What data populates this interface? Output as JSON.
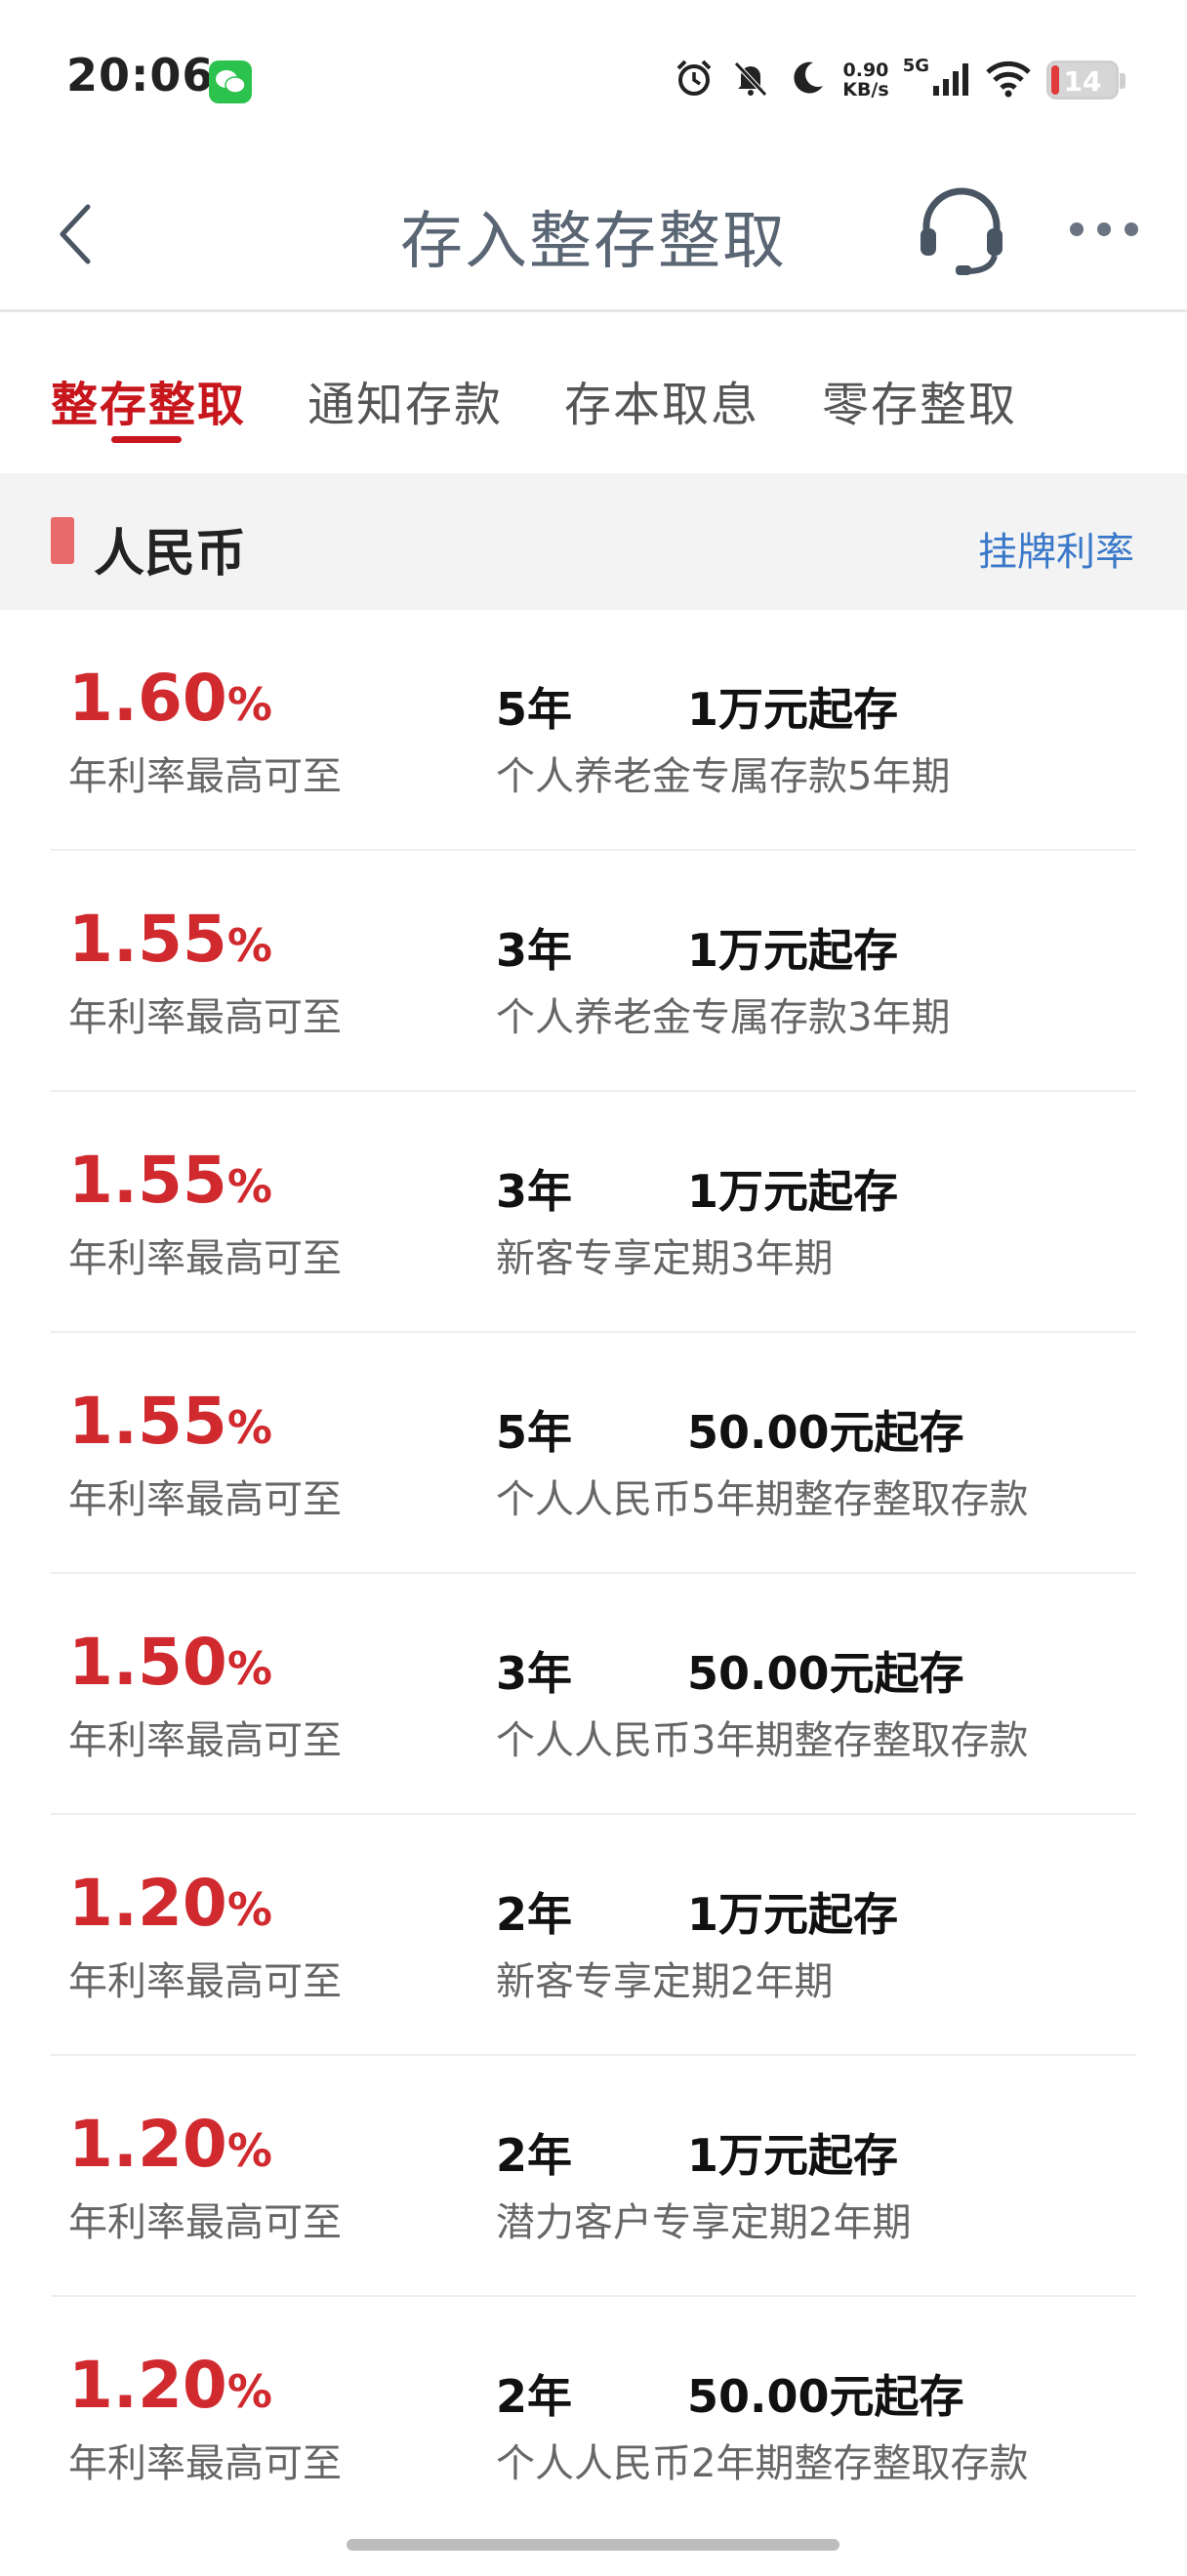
{
  "status_bar": {
    "time": "20:06",
    "net_speed_value": "0.90",
    "net_speed_unit": "KB/s",
    "network_type": "5G",
    "battery_level": "14",
    "icons": [
      "wechat-icon",
      "alarm-icon",
      "mute-icon",
      "moon-icon",
      "signal-icon",
      "wifi-icon",
      "battery-icon"
    ]
  },
  "header": {
    "title": "存入整存整取",
    "icons": [
      "back-arrow-icon",
      "headset-icon",
      "more-icon"
    ]
  },
  "tabs": [
    {
      "label": "整存整取",
      "active": true
    },
    {
      "label": "通知存款",
      "active": false
    },
    {
      "label": "存本取息",
      "active": false
    },
    {
      "label": "零存整取",
      "active": false
    }
  ],
  "section": {
    "title": "人民币",
    "link": "挂牌利率"
  },
  "products": [
    {
      "rate": "1.60",
      "rate_unit": "%",
      "caption": "年利率最高可至",
      "term": "5年",
      "min_deposit": "1万元起存",
      "name": "个人养老金专属存款5年期"
    },
    {
      "rate": "1.55",
      "rate_unit": "%",
      "caption": "年利率最高可至",
      "term": "3年",
      "min_deposit": "1万元起存",
      "name": "个人养老金专属存款3年期"
    },
    {
      "rate": "1.55",
      "rate_unit": "%",
      "caption": "年利率最高可至",
      "term": "3年",
      "min_deposit": "1万元起存",
      "name": "新客专享定期3年期"
    },
    {
      "rate": "1.55",
      "rate_unit": "%",
      "caption": "年利率最高可至",
      "term": "5年",
      "min_deposit": "50.00元起存",
      "name": "个人人民币5年期整存整取存款"
    },
    {
      "rate": "1.50",
      "rate_unit": "%",
      "caption": "年利率最高可至",
      "term": "3年",
      "min_deposit": "50.00元起存",
      "name": "个人人民币3年期整存整取存款"
    },
    {
      "rate": "1.20",
      "rate_unit": "%",
      "caption": "年利率最高可至",
      "term": "2年",
      "min_deposit": "1万元起存",
      "name": "新客专享定期2年期"
    },
    {
      "rate": "1.20",
      "rate_unit": "%",
      "caption": "年利率最高可至",
      "term": "2年",
      "min_deposit": "1万元起存",
      "name": "潜力客户专享定期2年期"
    },
    {
      "rate": "1.20",
      "rate_unit": "%",
      "caption": "年利率最高可至",
      "term": "2年",
      "min_deposit": "50.00元起存",
      "name": "个人人民币2年期整存整取存款"
    }
  ],
  "colors": {
    "accent_red": "#c8161d",
    "rate_red": "#d02a2f",
    "link_blue": "#3a78c9",
    "section_bg": "#f3f3f3"
  }
}
